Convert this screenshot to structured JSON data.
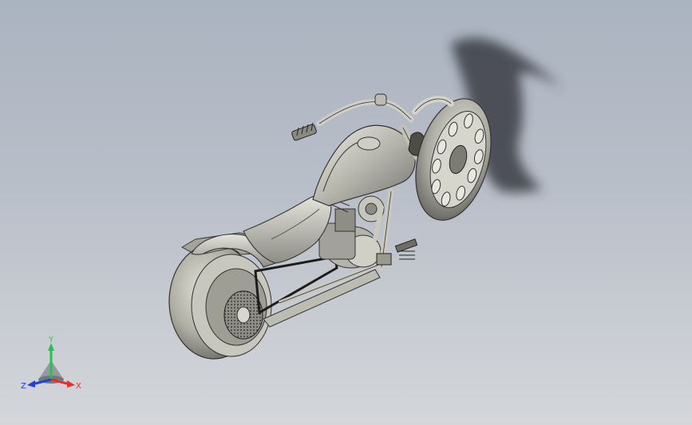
{
  "viewport": {
    "background_top": "#aab3c0",
    "background_bottom": "#d4d6da",
    "model_color": "#b9b8ad",
    "shadow_color": "#3a3d44"
  },
  "triad": {
    "x_label": "X",
    "y_label": "Y",
    "z_label": "Z",
    "x_color": "#e03030",
    "y_color": "#2cc04a",
    "z_color": "#2040e0"
  }
}
